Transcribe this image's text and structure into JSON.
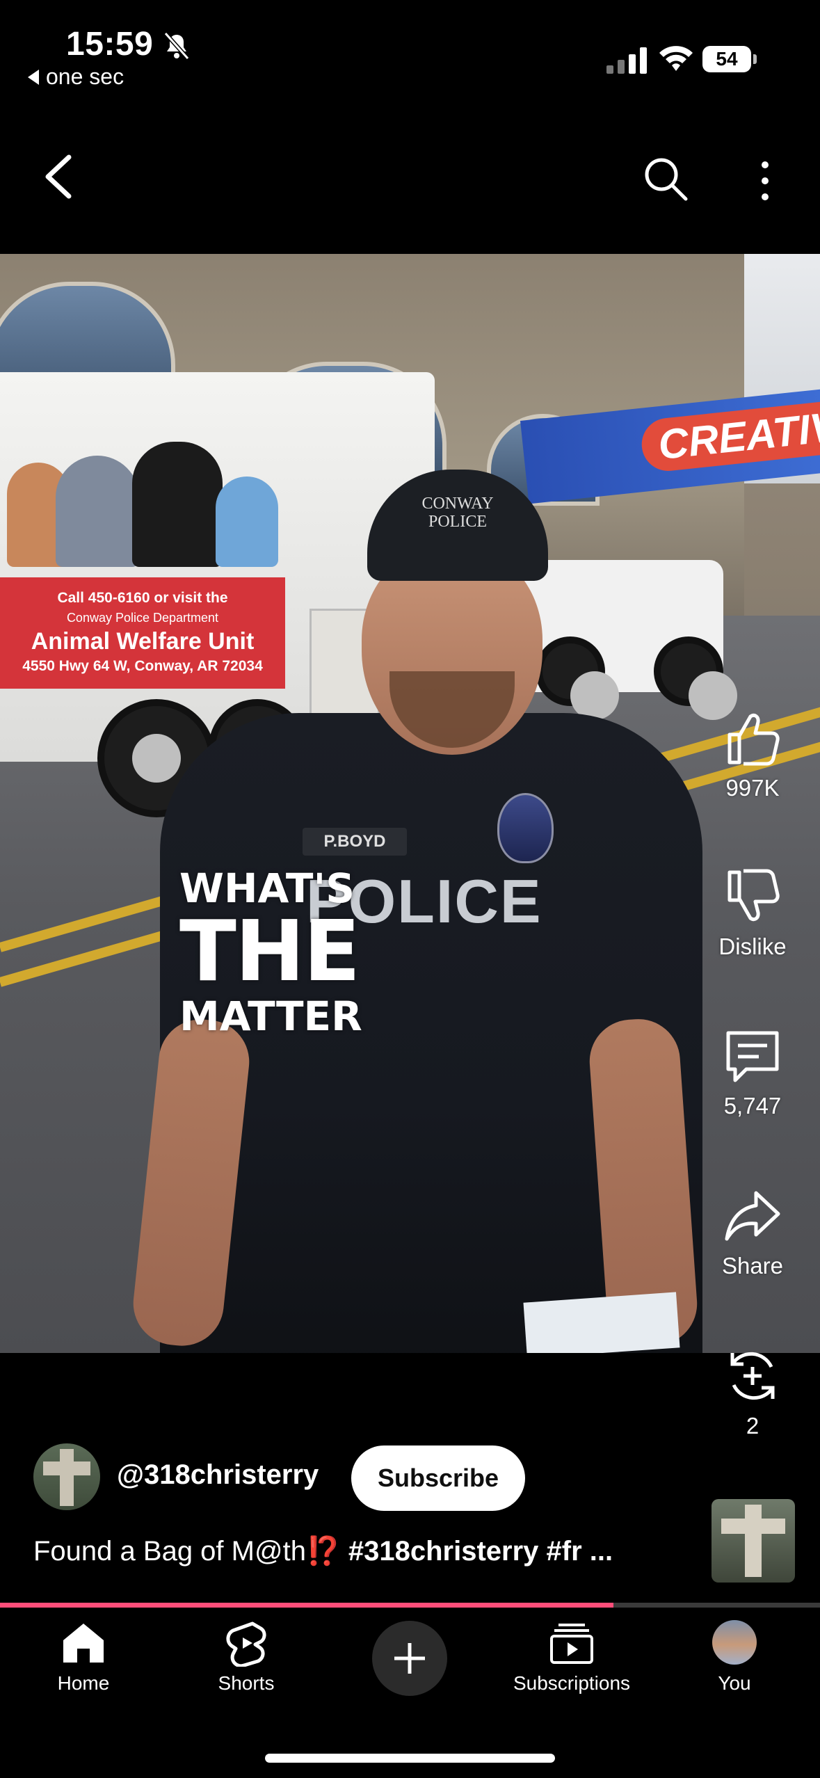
{
  "status_bar": {
    "time": "15:59",
    "back_app": "one sec",
    "battery": "54",
    "signal_bars_active": 2
  },
  "top_bar": {
    "back_icon": "chevron-left-icon",
    "search_icon": "search-icon",
    "more_icon": "more-vertical-icon"
  },
  "video": {
    "overlay_line1": "WHAT'S",
    "overlay_line2": "THE",
    "overlay_line3": "MATTER",
    "cap_line1": "CONWAY",
    "cap_line2": "POLICE",
    "vest_text": "POLICE",
    "nameplate": "P.BOYD",
    "trailer_line1": "Call 450-6160 or visit the",
    "trailer_line2": "Conway Police Department",
    "trailer_line3": "Animal Welfare Unit",
    "trailer_line4": "4550 Hwy 64 W, Conway, AR 72034",
    "banner_text": "CREATIV"
  },
  "actions": {
    "like_count": "997K",
    "dislike_label": "Dislike",
    "comment_count": "5,747",
    "share_label": "Share",
    "remix_count": "2"
  },
  "channel": {
    "handle": "@318christerry",
    "subscribe_label": "Subscribe"
  },
  "video_title": {
    "text": "Found a Bag of M@th",
    "emoji": "⁉️",
    "tags": " #318christerry #fr ..."
  },
  "progress": {
    "fraction": 0.748
  },
  "bottom_nav": {
    "home": "Home",
    "shorts": "Shorts",
    "subscriptions": "Subscriptions",
    "you": "You"
  },
  "colors": {
    "background": "#000000",
    "progress": "#ff4e7a",
    "subscribe_bg": "#ffffff"
  }
}
